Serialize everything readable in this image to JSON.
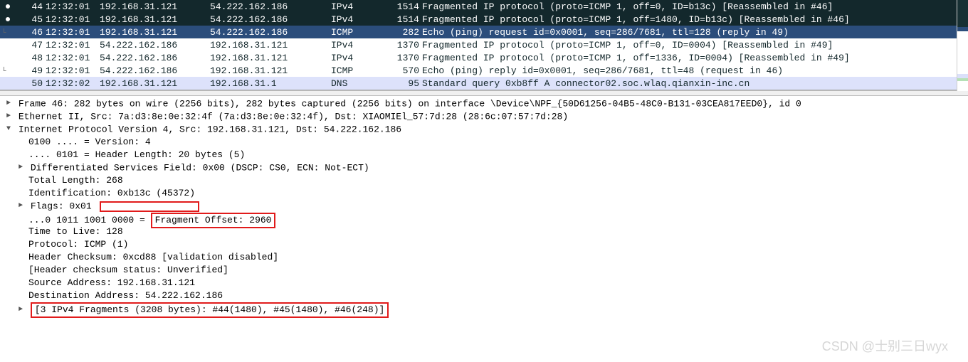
{
  "packets": [
    {
      "marker": "dot",
      "no": "44",
      "time": "12:32:01",
      "src": "192.168.31.121",
      "dst": "54.222.162.186",
      "proto": "IPv4",
      "len": "1514",
      "info": "Fragmented IP protocol (proto=ICMP 1, off=0, ID=b13c) [Reassembled in #46]",
      "style": "row-dark"
    },
    {
      "marker": "dot",
      "no": "45",
      "time": "12:32:01",
      "src": "192.168.31.121",
      "dst": "54.222.162.186",
      "proto": "IPv4",
      "len": "1514",
      "info": "Fragmented IP protocol (proto=ICMP 1, off=1480, ID=b13c) [Reassembled in #46]",
      "style": "row-dark"
    },
    {
      "marker": "end",
      "no": "46",
      "time": "12:32:01",
      "src": "192.168.31.121",
      "dst": "54.222.162.186",
      "proto": "ICMP",
      "len": "282",
      "info": "Echo (ping) request  id=0x0001, seq=286/7681, ttl=128 (reply in 49)",
      "style": "row-selected"
    },
    {
      "marker": "",
      "no": "47",
      "time": "12:32:01",
      "src": "54.222.162.186",
      "dst": "192.168.31.121",
      "proto": "IPv4",
      "len": "1370",
      "info": "Fragmented IP protocol (proto=ICMP 1, off=0, ID=0004) [Reassembled in #49]",
      "style": "row-light"
    },
    {
      "marker": "",
      "no": "48",
      "time": "12:32:01",
      "src": "54.222.162.186",
      "dst": "192.168.31.121",
      "proto": "IPv4",
      "len": "1370",
      "info": "Fragmented IP protocol (proto=ICMP 1, off=1336, ID=0004) [Reassembled in #49]",
      "style": "row-light"
    },
    {
      "marker": "end",
      "no": "49",
      "time": "12:32:01",
      "src": "54.222.162.186",
      "dst": "192.168.31.121",
      "proto": "ICMP",
      "len": "570",
      "info": "Echo (ping) reply    id=0x0001, seq=286/7681, ttl=48 (request in 46)",
      "style": "row-light"
    },
    {
      "marker": "",
      "no": "50",
      "time": "12:32:02",
      "src": "192.168.31.121",
      "dst": "192.168.31.1",
      "proto": "DNS",
      "len": "95",
      "info": "Standard query 0xb8ff A connector02.soc.wlaq.qianxin-inc.cn",
      "style": "row-lavender"
    }
  ],
  "details": {
    "frame": "Frame 46: 282 bytes on wire (2256 bits), 282 bytes captured (2256 bits) on interface \\Device\\NPF_{50D61256-04B5-48C0-B131-03CEA817EED0}, id 0",
    "eth": "Ethernet II, Src: 7a:d3:8e:0e:32:4f (7a:d3:8e:0e:32:4f), Dst: XIAOMIEl_57:7d:28 (28:6c:07:57:7d:28)",
    "ip_header": "Internet Protocol Version 4, Src: 192.168.31.121, Dst: 54.222.162.186",
    "version": "0100 .... = Version: 4",
    "hlen": ".... 0101 = Header Length: 20 bytes (5)",
    "dsfield": "Differentiated Services Field: 0x00 (DSCP: CS0, ECN: Not-ECT)",
    "total_length": "Total Length: 268",
    "identification": "Identification: 0xb13c (45372)",
    "flags": "Flags: 0x01",
    "frag_bits": "...0 1011 1001 0000 = ",
    "frag_offset": "Fragment Offset: 2960",
    "ttl": "Time to Live: 128",
    "protocol": "Protocol: ICMP (1)",
    "checksum": "Header Checksum: 0xcd88 [validation disabled]",
    "checksum_status": "[Header checksum status: Unverified]",
    "src_addr": "Source Address: 192.168.31.121",
    "dst_addr": "Destination Address: 54.222.162.186",
    "fragments": "[3 IPv4 Fragments (3208 bytes): #44(1480), #45(1480), #46(248)]"
  },
  "watermark": "CSDN @士别三日wyx"
}
